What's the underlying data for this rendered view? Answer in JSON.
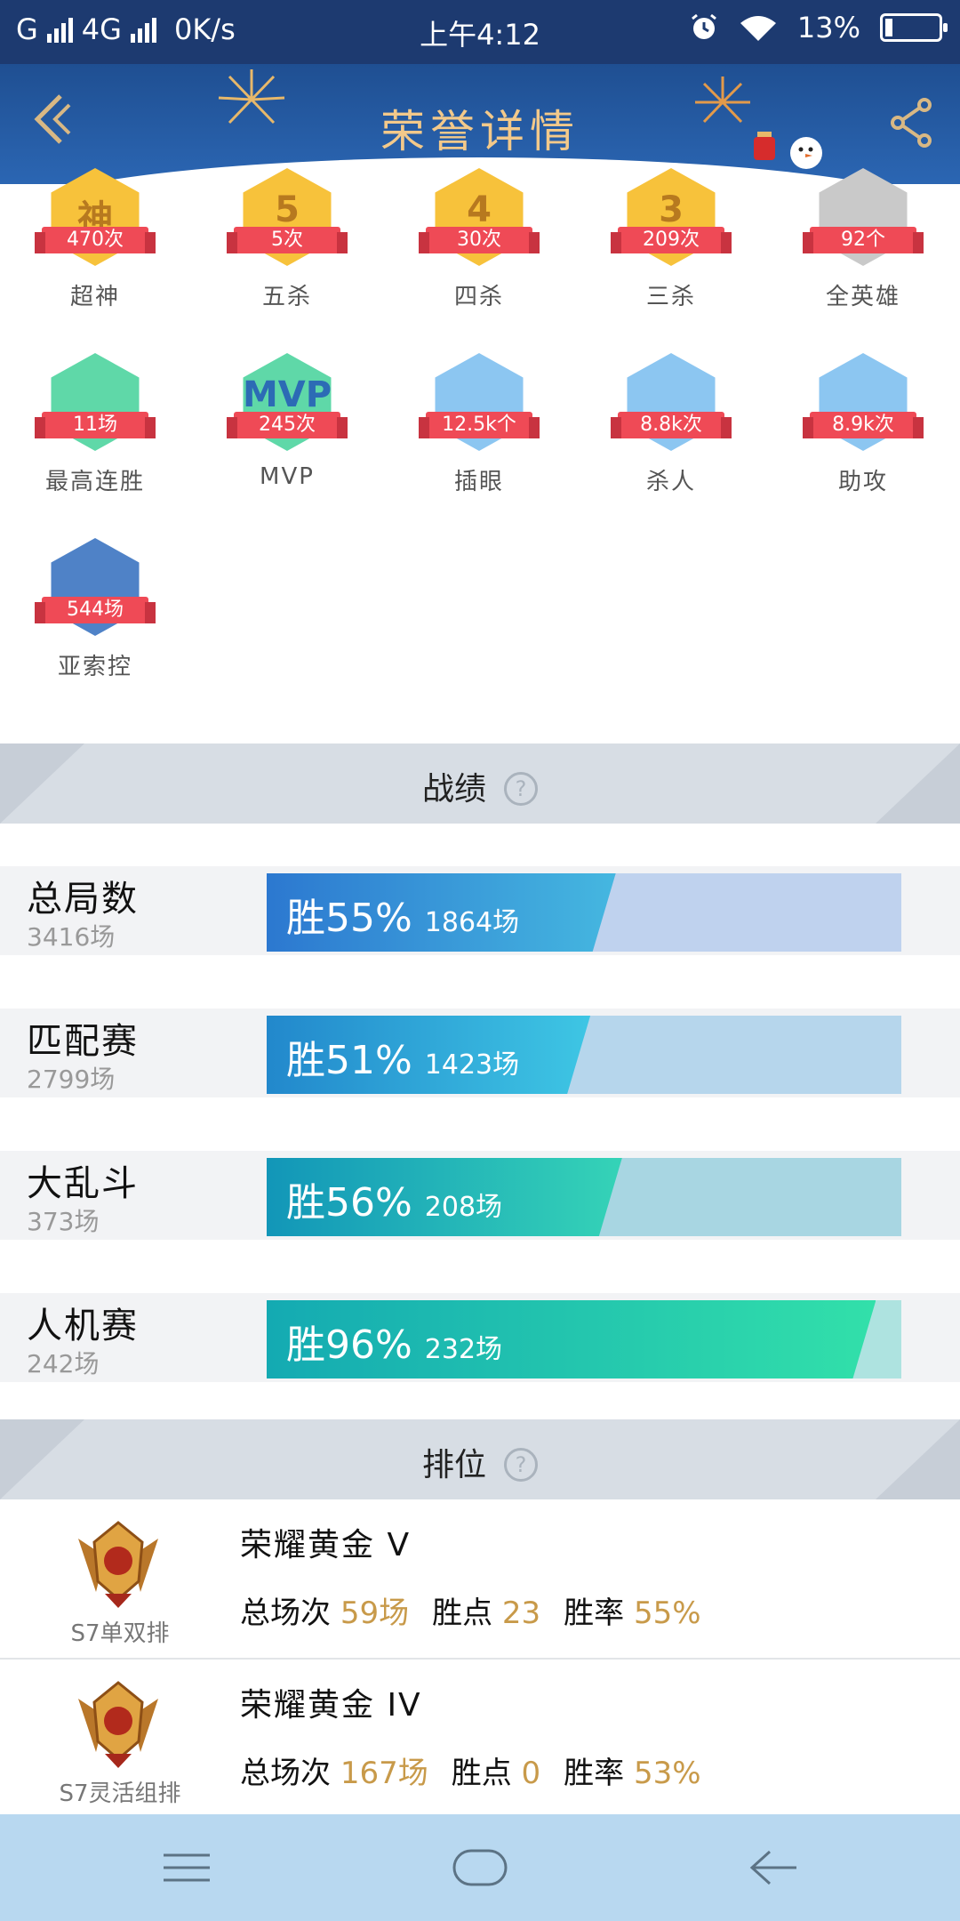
{
  "status_bar": {
    "carrier": "G",
    "network": "4G",
    "speed": "0K/s",
    "time": "上午4:12",
    "battery": "13%"
  },
  "header": {
    "title": "荣誉详情"
  },
  "honors": [
    {
      "label": "超神",
      "count": "470次",
      "glyph": "神",
      "color": "#f7c23b"
    },
    {
      "label": "五杀",
      "count": "5次",
      "glyph": "5",
      "color": "#f7c23b"
    },
    {
      "label": "四杀",
      "count": "30次",
      "glyph": "4",
      "color": "#f7c23b"
    },
    {
      "label": "三杀",
      "count": "209次",
      "glyph": "3",
      "color": "#f7c23b"
    },
    {
      "label": "全英雄",
      "count": "92个",
      "glyph": "",
      "color": "#c9c9c9"
    },
    {
      "label": "最高连胜",
      "count": "11场",
      "glyph": "",
      "color": "#5fd8a8"
    },
    {
      "label": "MVP",
      "count": "245次",
      "glyph": "MVP",
      "color": "#5fd8a8"
    },
    {
      "label": "插眼",
      "count": "12.5k个",
      "glyph": "",
      "color": "#8cc6f1"
    },
    {
      "label": "杀人",
      "count": "8.8k次",
      "glyph": "",
      "color": "#8cc6f1"
    },
    {
      "label": "助攻",
      "count": "8.9k次",
      "glyph": "",
      "color": "#8cc6f1"
    },
    {
      "label": "亚索控",
      "count": "544场",
      "glyph": "",
      "color": "#4f82c7"
    }
  ],
  "record_section": {
    "title": "战绩",
    "help": "?"
  },
  "records": [
    {
      "name": "总局数",
      "total": "3416场",
      "win": "胜55%",
      "games": "1864场",
      "fraction": 0.55,
      "color_a": "#2c78d0",
      "color_b": "#45b7e0",
      "track": "#bfd2ee"
    },
    {
      "name": "匹配赛",
      "total": "2799场",
      "win": "胜51%",
      "games": "1423场",
      "fraction": 0.51,
      "color_a": "#2288cc",
      "color_b": "#3ec6e4",
      "track": "#b6d6ec"
    },
    {
      "name": "大乱斗",
      "total": "373场",
      "win": "胜56%",
      "games": "208场",
      "fraction": 0.56,
      "color_a": "#1296b8",
      "color_b": "#35d3b7",
      "track": "#a8d6e2"
    },
    {
      "name": "人机赛",
      "total": "242场",
      "win": "胜96%",
      "games": "232场",
      "fraction": 0.96,
      "color_a": "#14aab2",
      "color_b": "#32e0aa",
      "track": "#aee3e0"
    }
  ],
  "rank_section": {
    "title": "排位",
    "help": "?"
  },
  "ranks": [
    {
      "tier": "荣耀黄金 V",
      "season": "S7单双排",
      "games_label": "总场次",
      "games": "59场",
      "points_label": "胜点",
      "points": "23",
      "rate_label": "胜率",
      "rate": "55%"
    },
    {
      "tier": "荣耀黄金 IV",
      "season": "S7灵活组排",
      "games_label": "总场次",
      "games": "167场",
      "points_label": "胜点",
      "points": "0",
      "rate_label": "胜率",
      "rate": "53%"
    }
  ]
}
